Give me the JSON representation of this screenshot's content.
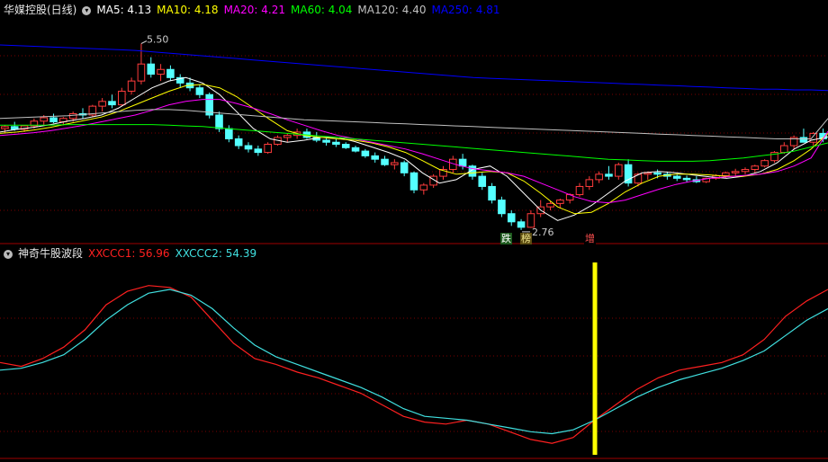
{
  "main_panel": {
    "stock_name": "华媒控股(日线)",
    "indicators": [
      {
        "label": "MA5: ",
        "value": "4.13",
        "color": "#ffffff"
      },
      {
        "label": "MA10: ",
        "value": "4.18",
        "color": "#ffff00"
      },
      {
        "label": "MA20: ",
        "value": "4.21",
        "color": "#ff00ff"
      },
      {
        "label": "MA60: ",
        "value": "4.04",
        "color": "#00ff00"
      },
      {
        "label": "MA120: ",
        "value": "4.40",
        "color": "#c0c0c0"
      },
      {
        "label": "MA250: ",
        "value": "4.81",
        "color": "#0000ff"
      }
    ],
    "price_high_label": "5.50",
    "price_low_label": "2.76",
    "tags": {
      "die": "跌",
      "bang": "榜",
      "zeng": "增"
    }
  },
  "sub_panel": {
    "indicator_name": "神奇牛股波段",
    "series": [
      {
        "label": "XXCCC1: ",
        "value": "56.96",
        "color": "#ff2020"
      },
      {
        "label": "XXCCC2: ",
        "value": "54.39",
        "color": "#40e0e0"
      }
    ]
  },
  "chart_data": [
    {
      "type": "candlestick",
      "title": "华媒控股(日线)",
      "candles": [
        [
          4.25,
          4.3,
          4.18,
          4.28
        ],
        [
          4.28,
          4.35,
          4.22,
          4.24
        ],
        [
          4.24,
          4.3,
          4.2,
          4.29
        ],
        [
          4.29,
          4.4,
          4.25,
          4.36
        ],
        [
          4.36,
          4.45,
          4.3,
          4.41
        ],
        [
          4.41,
          4.47,
          4.33,
          4.35
        ],
        [
          4.35,
          4.42,
          4.3,
          4.4
        ],
        [
          4.4,
          4.5,
          4.35,
          4.47
        ],
        [
          4.47,
          4.55,
          4.4,
          4.45
        ],
        [
          4.45,
          4.6,
          4.42,
          4.58
        ],
        [
          4.58,
          4.7,
          4.5,
          4.65
        ],
        [
          4.65,
          4.75,
          4.55,
          4.6
        ],
        [
          4.6,
          4.85,
          4.58,
          4.8
        ],
        [
          4.8,
          5.0,
          4.75,
          4.95
        ],
        [
          4.95,
          5.5,
          4.9,
          5.2
        ],
        [
          5.2,
          5.3,
          5.0,
          5.05
        ],
        [
          5.05,
          5.2,
          4.95,
          5.12
        ],
        [
          5.12,
          5.18,
          4.95,
          5.0
        ],
        [
          5.0,
          5.05,
          4.85,
          4.92
        ],
        [
          4.92,
          5.0,
          4.8,
          4.85
        ],
        [
          4.85,
          4.9,
          4.7,
          4.75
        ],
        [
          4.75,
          4.78,
          4.4,
          4.45
        ],
        [
          4.45,
          4.5,
          4.2,
          4.25
        ],
        [
          4.25,
          4.3,
          4.05,
          4.1
        ],
        [
          4.1,
          4.15,
          3.95,
          4.0
        ],
        [
          4.0,
          4.05,
          3.9,
          3.95
        ],
        [
          3.95,
          4.0,
          3.85,
          3.9
        ],
        [
          3.9,
          4.05,
          3.88,
          4.02
        ],
        [
          4.02,
          4.15,
          4.0,
          4.12
        ],
        [
          4.12,
          4.18,
          4.05,
          4.15
        ],
        [
          4.15,
          4.25,
          4.1,
          4.2
        ],
        [
          4.2,
          4.25,
          4.1,
          4.12
        ],
        [
          4.12,
          4.2,
          4.05,
          4.08
        ],
        [
          4.08,
          4.12,
          4.0,
          4.05
        ],
        [
          4.05,
          4.1,
          3.98,
          4.02
        ],
        [
          4.02,
          4.05,
          3.95,
          3.97
        ],
        [
          3.97,
          4.0,
          3.9,
          3.92
        ],
        [
          3.92,
          3.95,
          3.82,
          3.85
        ],
        [
          3.85,
          3.9,
          3.75,
          3.8
        ],
        [
          3.8,
          3.85,
          3.7,
          3.72
        ],
        [
          3.72,
          3.8,
          3.65,
          3.75
        ],
        [
          3.75,
          3.78,
          3.55,
          3.6
        ],
        [
          3.6,
          3.62,
          3.3,
          3.35
        ],
        [
          3.35,
          3.45,
          3.28,
          3.42
        ],
        [
          3.42,
          3.58,
          3.38,
          3.55
        ],
        [
          3.55,
          3.7,
          3.5,
          3.65
        ],
        [
          3.65,
          3.85,
          3.6,
          3.8
        ],
        [
          3.8,
          3.88,
          3.65,
          3.7
        ],
        [
          3.7,
          3.72,
          3.5,
          3.55
        ],
        [
          3.55,
          3.6,
          3.35,
          3.4
        ],
        [
          3.4,
          3.45,
          3.15,
          3.2
        ],
        [
          3.2,
          3.25,
          2.95,
          3.0
        ],
        [
          3.0,
          3.05,
          2.82,
          2.88
        ],
        [
          2.88,
          2.92,
          2.76,
          2.8
        ],
        [
          2.8,
          3.05,
          2.79,
          3.0
        ],
        [
          3.0,
          3.2,
          2.95,
          3.1
        ],
        [
          3.1,
          3.18,
          3.05,
          3.15
        ],
        [
          3.15,
          3.22,
          3.08,
          3.2
        ],
        [
          3.2,
          3.3,
          3.15,
          3.28
        ],
        [
          3.28,
          3.45,
          3.25,
          3.4
        ],
        [
          3.4,
          3.55,
          3.35,
          3.5
        ],
        [
          3.5,
          3.62,
          3.45,
          3.58
        ],
        [
          3.58,
          3.7,
          3.5,
          3.55
        ],
        [
          3.55,
          3.75,
          3.5,
          3.72
        ],
        [
          3.72,
          3.8,
          3.4,
          3.45
        ],
        [
          3.45,
          3.6,
          3.4,
          3.58
        ],
        [
          3.58,
          3.62,
          3.5,
          3.6
        ],
        [
          3.6,
          3.65,
          3.52,
          3.58
        ],
        [
          3.58,
          3.62,
          3.5,
          3.55
        ],
        [
          3.55,
          3.58,
          3.48,
          3.52
        ],
        [
          3.52,
          3.56,
          3.46,
          3.5
        ],
        [
          3.5,
          3.55,
          3.45,
          3.47
        ],
        [
          3.47,
          3.53,
          3.45,
          3.52
        ],
        [
          3.52,
          3.58,
          3.5,
          3.56
        ],
        [
          3.56,
          3.62,
          3.52,
          3.6
        ],
        [
          3.6,
          3.66,
          3.55,
          3.62
        ],
        [
          3.62,
          3.68,
          3.58,
          3.65
        ],
        [
          3.65,
          3.72,
          3.6,
          3.7
        ],
        [
          3.7,
          3.8,
          3.68,
          3.78
        ],
        [
          3.78,
          3.92,
          3.75,
          3.9
        ],
        [
          3.9,
          4.05,
          3.88,
          4.0
        ],
        [
          4.0,
          4.15,
          3.95,
          4.12
        ],
        [
          4.12,
          4.25,
          4.05,
          4.05
        ],
        [
          4.05,
          4.2,
          3.98,
          4.18
        ],
        [
          4.18,
          4.25,
          4.05,
          4.1
        ]
      ],
      "ma": [
        {
          "name": "MA5",
          "color": "#ffffff",
          "values": [
            4.2,
            4.24,
            4.27,
            4.31,
            4.36,
            4.4,
            4.45,
            4.55,
            4.7,
            4.85,
            4.95,
            5.0,
            4.92,
            4.75,
            4.5,
            4.25,
            4.1,
            4.05,
            4.08,
            4.12,
            4.12,
            4.06,
            3.98,
            3.9,
            3.8,
            3.6,
            3.45,
            3.5,
            3.65,
            3.7,
            3.55,
            3.3,
            3.05,
            2.9,
            2.98,
            3.12,
            3.3,
            3.48,
            3.6,
            3.62,
            3.6,
            3.57,
            3.54,
            3.52,
            3.55,
            3.62,
            3.75,
            3.95,
            4.08,
            4.13
          ]
        },
        {
          "name": "MA10",
          "color": "#ffff00",
          "values": [
            4.18,
            4.2,
            4.23,
            4.27,
            4.32,
            4.37,
            4.42,
            4.5,
            4.6,
            4.7,
            4.8,
            4.88,
            4.9,
            4.85,
            4.72,
            4.55,
            4.38,
            4.22,
            4.15,
            4.12,
            4.1,
            4.08,
            4.04,
            3.98,
            3.9,
            3.78,
            3.65,
            3.58,
            3.6,
            3.62,
            3.6,
            3.48,
            3.3,
            3.1,
            3.0,
            3.02,
            3.15,
            3.32,
            3.45,
            3.55,
            3.58,
            3.58,
            3.57,
            3.55,
            3.55,
            3.58,
            3.65,
            3.78,
            3.95,
            4.18
          ]
        },
        {
          "name": "MA20",
          "color": "#ff00ff",
          "values": [
            4.15,
            4.17,
            4.19,
            4.22,
            4.26,
            4.3,
            4.35,
            4.4,
            4.45,
            4.52,
            4.6,
            4.65,
            4.68,
            4.68,
            4.62,
            4.55,
            4.47,
            4.38,
            4.3,
            4.22,
            4.15,
            4.1,
            4.05,
            4.0,
            3.95,
            3.88,
            3.8,
            3.72,
            3.66,
            3.63,
            3.6,
            3.55,
            3.45,
            3.35,
            3.25,
            3.18,
            3.16,
            3.2,
            3.28,
            3.36,
            3.43,
            3.48,
            3.52,
            3.54,
            3.56,
            3.58,
            3.62,
            3.7,
            3.82,
            4.21
          ]
        },
        {
          "name": "MA60",
          "color": "#00ff00",
          "values": [
            4.3,
            4.3,
            4.3,
            4.3,
            4.31,
            4.31,
            4.31,
            4.31,
            4.31,
            4.31,
            4.3,
            4.29,
            4.28,
            4.26,
            4.24,
            4.22,
            4.2,
            4.18,
            4.16,
            4.14,
            4.12,
            4.1,
            4.08,
            4.06,
            4.04,
            4.02,
            4.0,
            3.98,
            3.96,
            3.94,
            3.92,
            3.9,
            3.88,
            3.86,
            3.84,
            3.82,
            3.8,
            3.79,
            3.78,
            3.77,
            3.77,
            3.77,
            3.78,
            3.8,
            3.82,
            3.85,
            3.88,
            3.92,
            3.98,
            4.04
          ]
        },
        {
          "name": "MA120",
          "color": "#c0c0c0",
          "values": [
            4.4,
            4.41,
            4.42,
            4.43,
            4.44,
            4.46,
            4.48,
            4.5,
            4.52,
            4.53,
            4.53,
            4.52,
            4.5,
            4.48,
            4.46,
            4.44,
            4.42,
            4.4,
            4.38,
            4.37,
            4.36,
            4.35,
            4.34,
            4.33,
            4.32,
            4.31,
            4.3,
            4.29,
            4.28,
            4.27,
            4.26,
            4.25,
            4.24,
            4.23,
            4.22,
            4.21,
            4.2,
            4.19,
            4.18,
            4.17,
            4.16,
            4.15,
            4.14,
            4.13,
            4.12,
            4.11,
            4.1,
            4.1,
            4.1,
            4.4
          ]
        },
        {
          "name": "MA250",
          "color": "#0000ff",
          "values": [
            5.48,
            5.47,
            5.46,
            5.45,
            5.44,
            5.43,
            5.42,
            5.41,
            5.4,
            5.38,
            5.36,
            5.34,
            5.32,
            5.3,
            5.28,
            5.26,
            5.24,
            5.22,
            5.2,
            5.18,
            5.16,
            5.14,
            5.12,
            5.1,
            5.08,
            5.06,
            5.04,
            5.02,
            5.0,
            4.99,
            4.98,
            4.97,
            4.96,
            4.95,
            4.94,
            4.93,
            4.92,
            4.91,
            4.9,
            4.89,
            4.88,
            4.87,
            4.86,
            4.85,
            4.84,
            4.83,
            4.83,
            4.82,
            4.82,
            4.81
          ]
        }
      ],
      "annotations": [
        {
          "text": "5.50",
          "type": "high"
        },
        {
          "text": "2.76",
          "type": "low"
        }
      ],
      "ylim": [
        2.6,
        5.85
      ]
    },
    {
      "type": "line",
      "title": "神奇牛股波段",
      "series": [
        {
          "name": "XXCCC1",
          "color": "#ff2020",
          "values": [
            58,
            56,
            60,
            66,
            75,
            88,
            95,
            98,
            97,
            92,
            80,
            68,
            60,
            57,
            53,
            50,
            46,
            42,
            36,
            30,
            27,
            26,
            28,
            26,
            22,
            18,
            16,
            19,
            28,
            36,
            44,
            50,
            54,
            56,
            58,
            62,
            70,
            82,
            90,
            96
          ]
        },
        {
          "name": "XXCCC2",
          "color": "#40e0e0",
          "values": [
            54,
            55,
            58,
            62,
            70,
            80,
            88,
            94,
            96,
            93,
            86,
            76,
            67,
            61,
            57,
            53,
            49,
            45,
            40,
            34,
            30,
            29,
            28,
            26,
            24,
            22,
            21,
            23,
            28,
            34,
            40,
            45,
            49,
            52,
            55,
            59,
            64,
            72,
            80,
            86
          ]
        }
      ],
      "ylim": [
        10,
        110
      ],
      "marker_index": 28
    }
  ]
}
